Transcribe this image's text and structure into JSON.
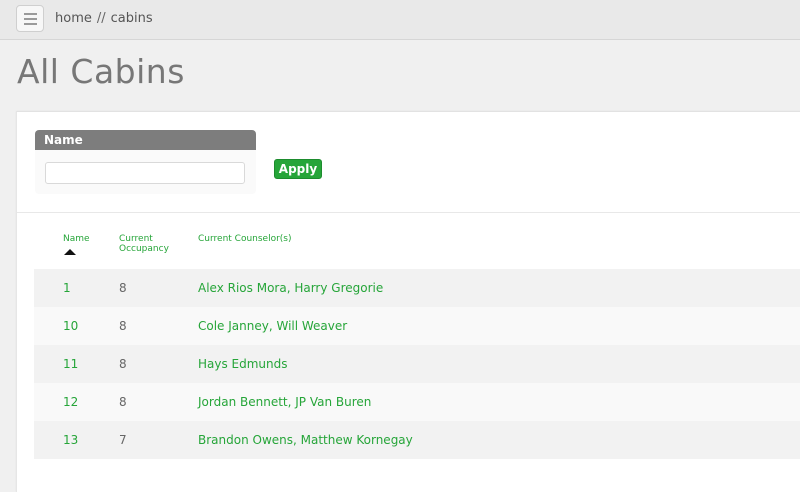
{
  "breadcrumb": {
    "home": "home",
    "separator": "//",
    "current": "cabins"
  },
  "page": {
    "title": "All Cabins"
  },
  "filter": {
    "header": "Name",
    "value": "",
    "placeholder": "",
    "apply_label": "Apply"
  },
  "table": {
    "headers": {
      "name": "Name",
      "occupancy": "Current Occupancy",
      "counselors": "Current Counselor(s)"
    },
    "sort": {
      "column": "Name",
      "direction": "ascending"
    },
    "rows": [
      {
        "name": "1",
        "occupancy": "8",
        "counselors": "Alex Rios Mora, Harry Gregorie"
      },
      {
        "name": "10",
        "occupancy": "8",
        "counselors": "Cole Janney, Will Weaver"
      },
      {
        "name": "11",
        "occupancy": "8",
        "counselors": "Hays Edmunds"
      },
      {
        "name": "12",
        "occupancy": "8",
        "counselors": "Jordan Bennett, JP Van Buren"
      },
      {
        "name": "13",
        "occupancy": "7",
        "counselors": "Brandon Owens, Matthew Kornegay"
      }
    ]
  },
  "colors": {
    "accent": "#26a539",
    "header_bar": "#7d7d7d",
    "title": "#777777"
  },
  "icons": {
    "menu": "hamburger-icon",
    "sort": "sort-ascending-icon"
  }
}
